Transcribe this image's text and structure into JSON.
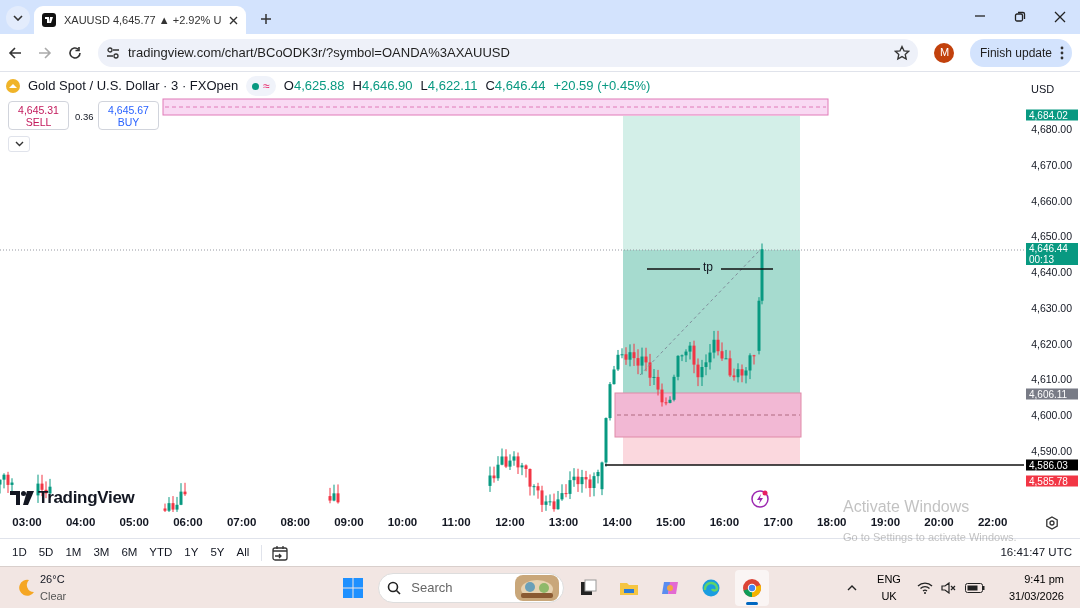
{
  "browser": {
    "tab": {
      "title": "XAUUSD 4,645.77 ▲ +2.92% U"
    },
    "url": "tradingview.com/chart/BCoODK3r/?symbol=OANDA%3AXAUUSD",
    "profile_initial": "M",
    "update_button": "Finish update"
  },
  "chart": {
    "symbol": "Gold Spot / U.S. Dollar · 3 · FXOpen",
    "status_symbol": "≈",
    "ohlc": [
      {
        "label": "O",
        "value": "4,625.88"
      },
      {
        "label": "H",
        "value": "4,646.90"
      },
      {
        "label": "L",
        "value": "4,622.11"
      },
      {
        "label": "C",
        "value": "4,646.44"
      }
    ],
    "change": "+20.59 (+0.45%)",
    "currency": "USD",
    "sell": {
      "price": "4,645.31",
      "label": "SELL"
    },
    "spread": "0.36",
    "buy": {
      "price": "4,645.67",
      "label": "BUY"
    },
    "tp_label": "tp",
    "price_ticks": [
      "4,680.00",
      "4,670.00",
      "4,660.00",
      "4,650.00",
      "4,640.00",
      "4,630.00",
      "4,620.00",
      "4,610.00",
      "4,600.00",
      "4,590.00"
    ],
    "price_badges": [
      {
        "text": "4,684.02",
        "color": "#089981"
      },
      {
        "text": "4,646.44",
        "sub": "00:13",
        "color": "#089981"
      },
      {
        "text": "4,606.11",
        "color": "#787b86"
      },
      {
        "text": "4,586.03",
        "color": "#000000"
      },
      {
        "text": "4,585.78",
        "color": "#f23645"
      }
    ],
    "time_ticks": [
      "03:00",
      "04:00",
      "05:00",
      "06:00",
      "07:00",
      "08:00",
      "09:00",
      "10:00",
      "11:00",
      "12:00",
      "13:00",
      "14:00",
      "15:00",
      "16:00",
      "17:00",
      "18:00",
      "19:00",
      "20:00",
      "22:00"
    ],
    "logo": "TradingView",
    "ranges": [
      "1D",
      "5D",
      "1M",
      "3M",
      "6M",
      "YTD",
      "1Y",
      "5Y",
      "All"
    ],
    "clock": "16:41:47 UTC"
  },
  "activation_notice": {
    "title": "Activate Windows",
    "text": "Go to Settings to activate Windows."
  },
  "taskbar": {
    "temperature": "26°C",
    "condition": "Clear",
    "search_placeholder": "Search",
    "apps": [
      {
        "kind": "tasks",
        "selected": false
      },
      {
        "kind": "folder",
        "selected": false
      },
      {
        "kind": "copilot",
        "selected": false
      },
      {
        "kind": "edge",
        "selected": false
      },
      {
        "kind": "chrome",
        "selected": true
      }
    ],
    "language": "ENG",
    "region": "UK",
    "time": "9:41 pm",
    "date": "31/03/2026"
  }
}
